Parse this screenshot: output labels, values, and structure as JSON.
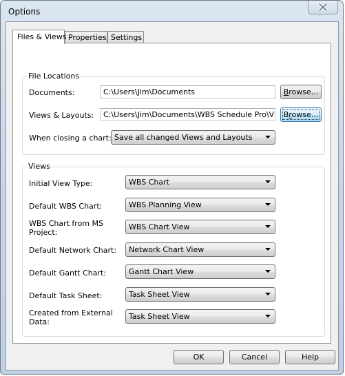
{
  "window": {
    "title": "Options",
    "close_icon": "close-icon"
  },
  "tabs": [
    {
      "label": "Files & Views",
      "active": true
    },
    {
      "label": "Properties",
      "active": false
    },
    {
      "label": "Settings",
      "active": false
    }
  ],
  "file_locations": {
    "group_label": "File Locations",
    "documents": {
      "label": "Documents:",
      "value": "C:\\Users\\Jim\\Documents",
      "browse_label_prefix": "",
      "browse_mnemonic": "B",
      "browse_label_suffix": "rowse..."
    },
    "views_layouts": {
      "label": "Views & Layouts:",
      "value": "C:\\Users\\Jim\\Documents\\WBS Schedule Pro\\Views and Layouts",
      "browse_label_prefix": "B",
      "browse_mnemonic": "r",
      "browse_label_suffix": "owse..."
    },
    "closing": {
      "label": "When closing a chart:",
      "value": "Save all changed Views and Layouts"
    }
  },
  "views": {
    "group_label": "Views",
    "rows": [
      {
        "label_line1": "Initial View Type:",
        "label_line2": "",
        "value": "WBS Chart"
      },
      {
        "label_line1": "Default WBS Chart:",
        "label_line2": "",
        "value": "WBS Planning View"
      },
      {
        "label_line1": "WBS Chart from MS",
        "label_line2": "Project:",
        "value": "WBS Chart View"
      },
      {
        "label_line1": "Default Network Chart:",
        "label_line2": "",
        "value": "Network Chart View"
      },
      {
        "label_line1": "Default Gantt Chart:",
        "label_line2": "",
        "value": "Gantt Chart View"
      },
      {
        "label_line1": "Default Task Sheet:",
        "label_line2": "",
        "value": "Task Sheet View"
      },
      {
        "label_line1": "Created from External",
        "label_line2": "Data:",
        "value": "Task Sheet View"
      }
    ]
  },
  "footer": {
    "ok_label": "OK",
    "cancel_label": "Cancel",
    "help_label": "Help"
  }
}
